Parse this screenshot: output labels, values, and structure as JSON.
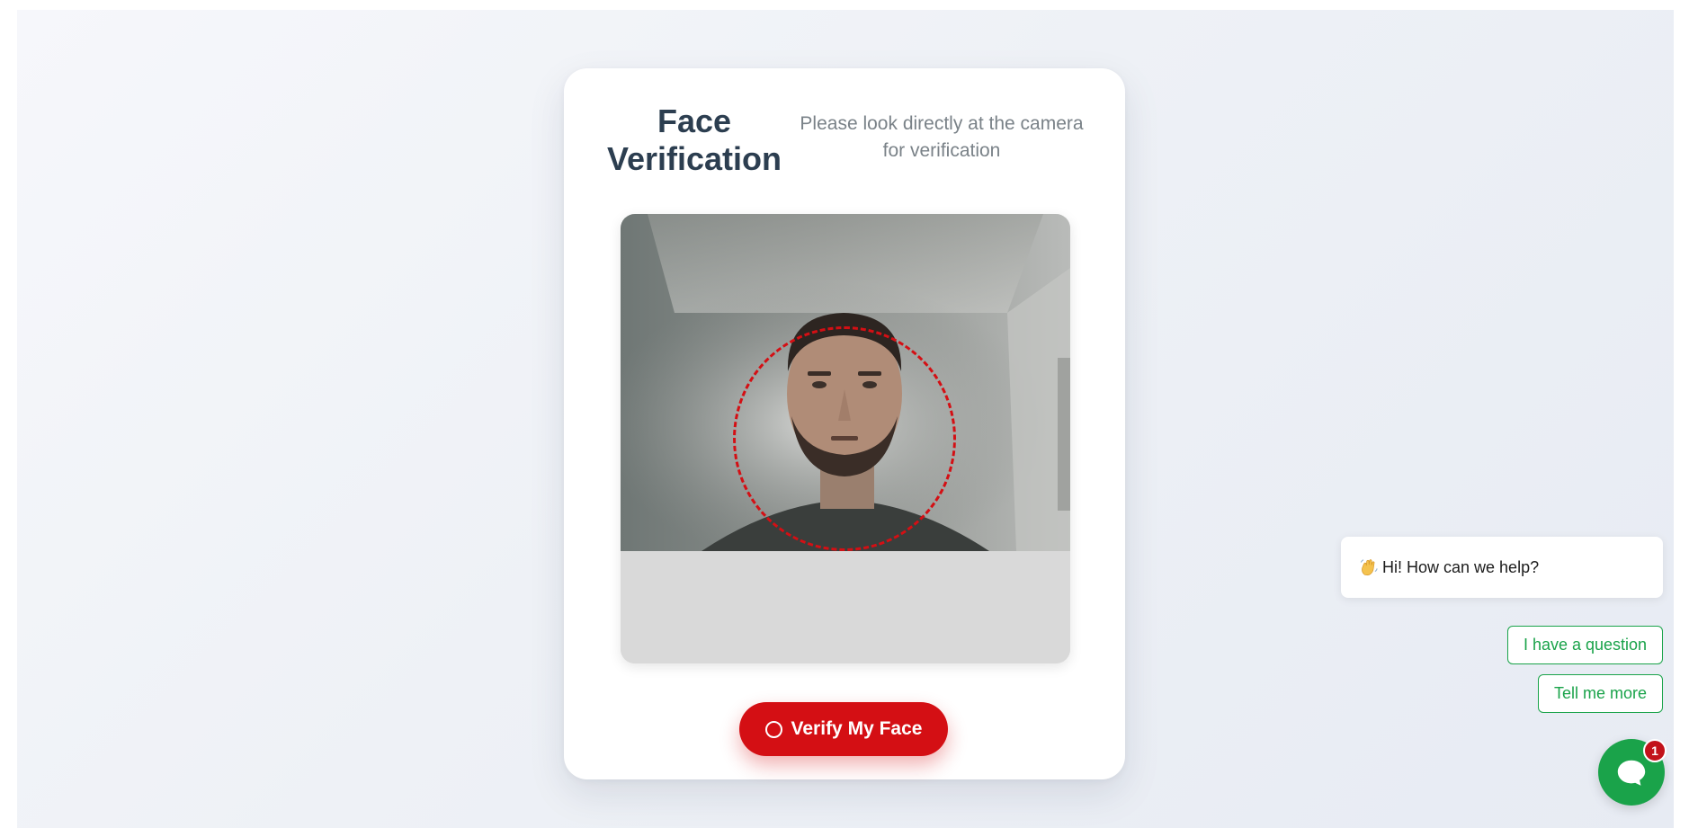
{
  "card": {
    "title": "Face Verification",
    "subtitle": "Please look directly at the camera for verification"
  },
  "camera": {
    "guide_color": "#d40f14",
    "guide_style": "dashed-circle"
  },
  "verify_button": {
    "label": "Verify My Face",
    "icon": "circle-outline-icon",
    "color": "#d40f14"
  },
  "chat": {
    "greeting_icon": "waving-hand-icon",
    "greeting": "Hi! How can we help?",
    "quick_replies": [
      "I have a question",
      "Tell me more"
    ],
    "launcher_icon": "chat-bubble-icon",
    "unread_count": "1",
    "accent": "#1aa34a",
    "badge_color": "#c2121a"
  }
}
